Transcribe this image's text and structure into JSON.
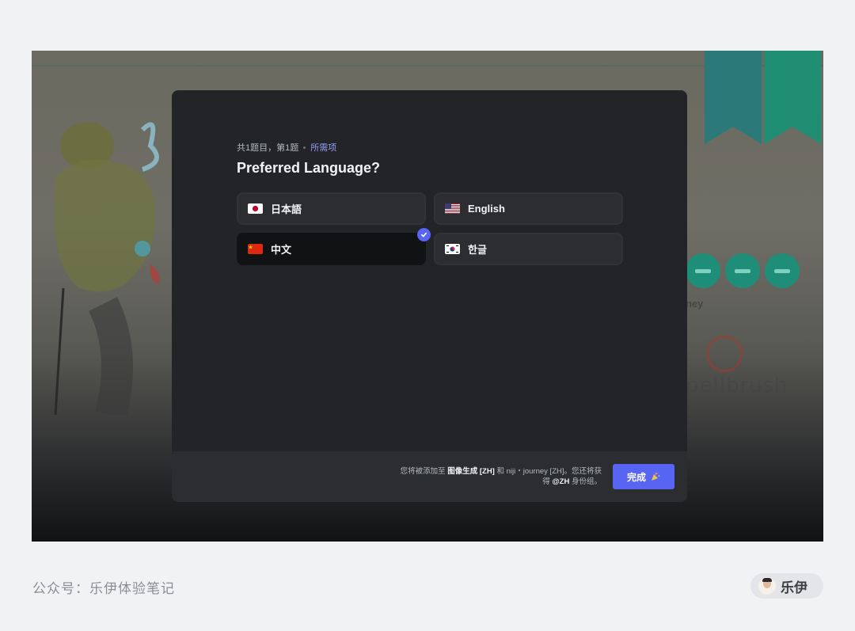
{
  "modal": {
    "progress": "共1题目，第1题",
    "required": "所需项",
    "question": "Preferred Language?",
    "options": [
      {
        "label": "日本語",
        "flag": "jp-flag-icon",
        "selected": false
      },
      {
        "label": "English",
        "flag": "us-flag-icon",
        "selected": false
      },
      {
        "label": "中文",
        "flag": "cn-flag-icon",
        "selected": true
      },
      {
        "label": "한글",
        "flag": "kr-flag-icon",
        "selected": false
      }
    ],
    "footer": {
      "note_prefix": "您将被添加至",
      "channel": "图像生成 [ZH]",
      "note_and": "和 niji・journey [ZH]。您还将获得",
      "role": "@ZH",
      "note_suffix": "身份组。",
      "done_label": "完成",
      "done_icon": "party-popper-icon"
    }
  },
  "background": {
    "word_large": "pellbrush",
    "word_small": "ney"
  },
  "caption": {
    "text": "公众号：乐伊体验笔记",
    "author": "乐伊"
  },
  "colors": {
    "accent": "#5865f2",
    "modal_bg": "#232428",
    "footer_bg": "#2b2d31",
    "required": "#949cf7"
  }
}
